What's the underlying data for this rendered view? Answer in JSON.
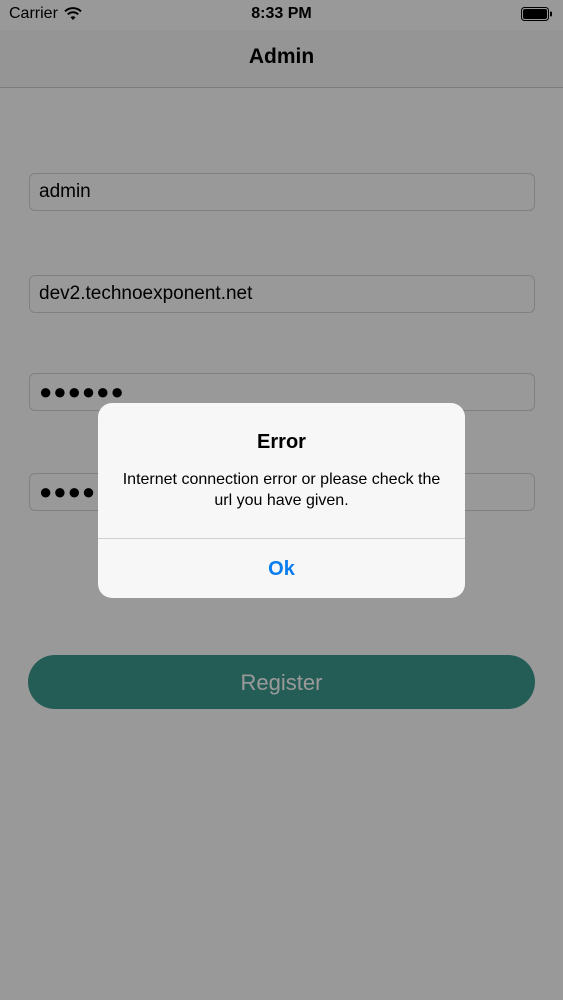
{
  "status_bar": {
    "carrier": "Carrier",
    "time": "8:33 PM",
    "wifi_icon": "wifi-icon",
    "battery_icon": "battery-icon"
  },
  "nav": {
    "title": "Admin"
  },
  "form": {
    "username_value": "admin",
    "url_value": "dev2.technoexponent.net",
    "password_value": "●●●●●●",
    "confirm_password_value": "●●●●●●",
    "register_label": "Register"
  },
  "alert": {
    "title": "Error",
    "message": "Internet connection error or please check the url you have given.",
    "ok_label": "Ok"
  },
  "colors": {
    "accent": "#3c9b8f",
    "alert_button": "#0a7ef0"
  }
}
